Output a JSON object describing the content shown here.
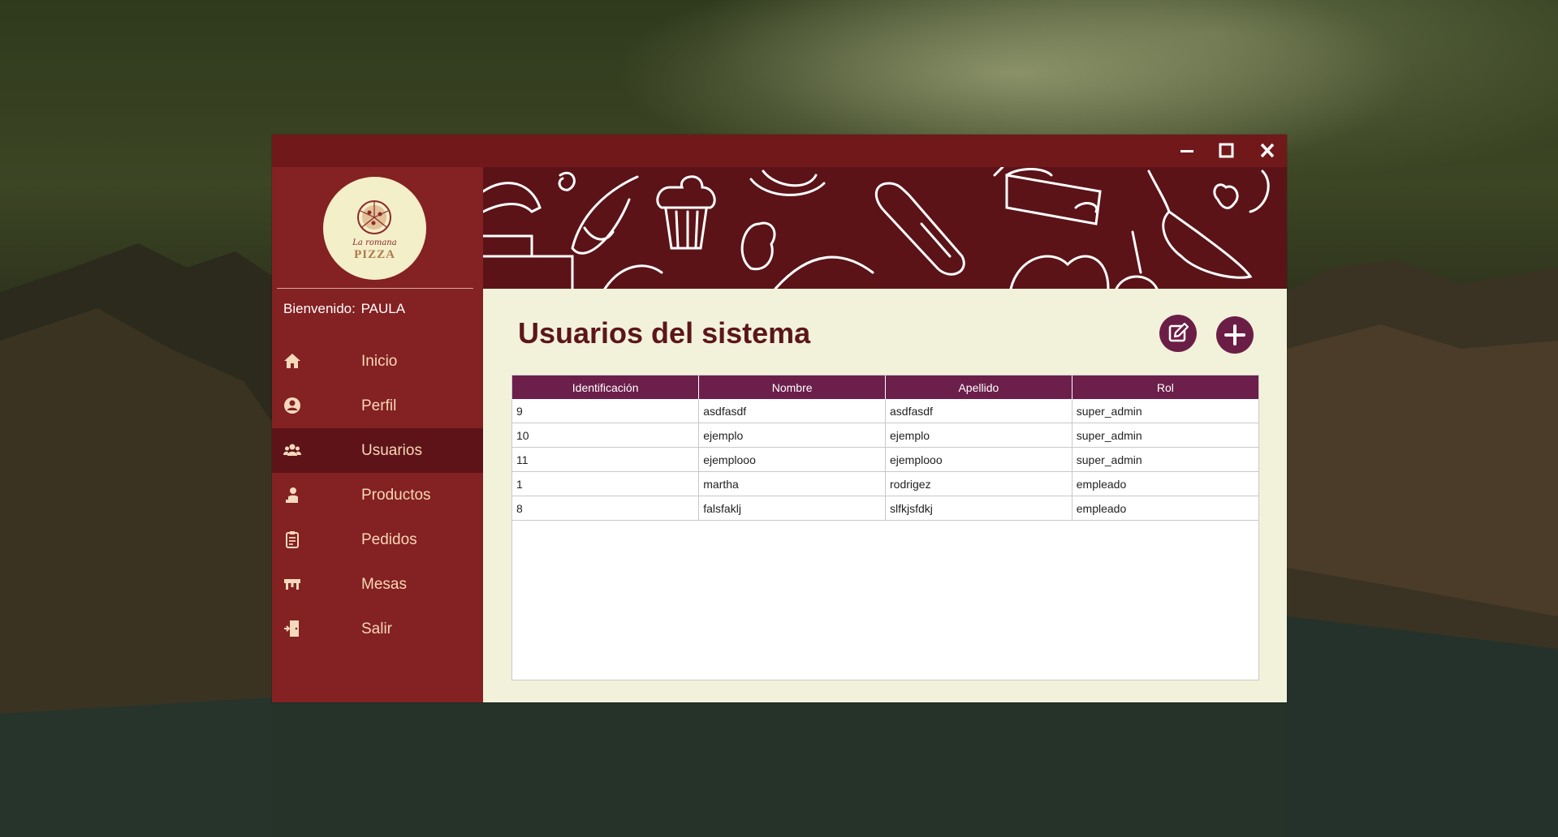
{
  "window": {
    "title_buttons": [
      "minimize-icon",
      "maximize-icon",
      "close-icon"
    ]
  },
  "sidebar": {
    "logo": {
      "line1": "La romana",
      "line2": "PIZZA"
    },
    "welcome_label": "Bienvenido:",
    "user_name": "PAULA",
    "items": [
      {
        "label": "Inicio",
        "icon": "home-icon",
        "active": false
      },
      {
        "label": "Perfil",
        "icon": "user-circle-icon",
        "active": false
      },
      {
        "label": "Usuarios",
        "icon": "users-icon",
        "active": true
      },
      {
        "label": "Productos",
        "icon": "chef-icon",
        "active": false
      },
      {
        "label": "Pedidos",
        "icon": "clipboard-icon",
        "active": false
      },
      {
        "label": "Mesas",
        "icon": "table-icon",
        "active": false
      },
      {
        "label": "Salir",
        "icon": "door-exit-icon",
        "active": false
      }
    ]
  },
  "main": {
    "title": "Usuarios del sistema",
    "actions": [
      {
        "icon": "edit-icon"
      },
      {
        "icon": "plus-icon"
      }
    ],
    "table": {
      "columns": [
        "Identificación",
        "Nombre",
        "Apellido",
        "Rol"
      ],
      "rows": [
        [
          "9",
          "asdfasdf",
          "asdfasdf",
          "super_admin"
        ],
        [
          "10",
          "ejemplo",
          "ejemplo",
          "super_admin"
        ],
        [
          "11",
          "ejemplooo",
          "ejemplooo",
          "super_admin"
        ],
        [
          "1",
          "martha",
          "rodrigez",
          "empleado"
        ],
        [
          "8",
          "falsfaklj",
          "slfkjsfdkj",
          "empleado"
        ]
      ]
    }
  },
  "colors": {
    "titlebar": "#71181a",
    "sidebar": "#842122",
    "sidebar_active": "#5e1319",
    "accent_purple": "#6b1e45",
    "content_bg": "#f2f2db",
    "title_text": "#5c161a"
  }
}
